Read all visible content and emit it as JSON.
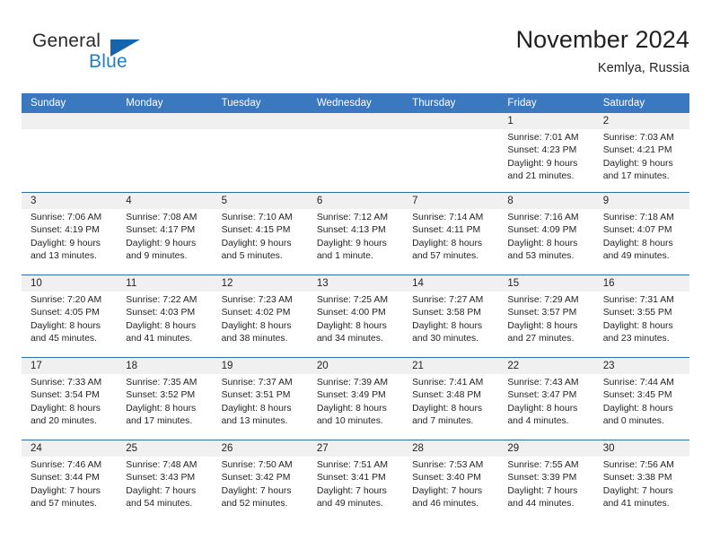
{
  "brand": {
    "name_part1": "General",
    "name_part2": "Blue",
    "triangle_color": "#1664ad",
    "blue_color": "#1f7fc6"
  },
  "header": {
    "title": "November 2024",
    "subtitle": "Kemlya, Russia"
  },
  "theme": {
    "header_row_bg": "#3b78bf",
    "day_number_bg": "#f0f0f0",
    "row_divider": "#2e6ba8",
    "text": "#231f20"
  },
  "weekdays": [
    "Sunday",
    "Monday",
    "Tuesday",
    "Wednesday",
    "Thursday",
    "Friday",
    "Saturday"
  ],
  "weeks": [
    [
      {
        "date": "",
        "sunrise": "",
        "sunset": "",
        "daylight_line1": "",
        "daylight_line2": ""
      },
      {
        "date": "",
        "sunrise": "",
        "sunset": "",
        "daylight_line1": "",
        "daylight_line2": ""
      },
      {
        "date": "",
        "sunrise": "",
        "sunset": "",
        "daylight_line1": "",
        "daylight_line2": ""
      },
      {
        "date": "",
        "sunrise": "",
        "sunset": "",
        "daylight_line1": "",
        "daylight_line2": ""
      },
      {
        "date": "",
        "sunrise": "",
        "sunset": "",
        "daylight_line1": "",
        "daylight_line2": ""
      },
      {
        "date": "1",
        "sunrise": "Sunrise: 7:01 AM",
        "sunset": "Sunset: 4:23 PM",
        "daylight_line1": "Daylight: 9 hours",
        "daylight_line2": "and 21 minutes."
      },
      {
        "date": "2",
        "sunrise": "Sunrise: 7:03 AM",
        "sunset": "Sunset: 4:21 PM",
        "daylight_line1": "Daylight: 9 hours",
        "daylight_line2": "and 17 minutes."
      }
    ],
    [
      {
        "date": "3",
        "sunrise": "Sunrise: 7:06 AM",
        "sunset": "Sunset: 4:19 PM",
        "daylight_line1": "Daylight: 9 hours",
        "daylight_line2": "and 13 minutes."
      },
      {
        "date": "4",
        "sunrise": "Sunrise: 7:08 AM",
        "sunset": "Sunset: 4:17 PM",
        "daylight_line1": "Daylight: 9 hours",
        "daylight_line2": "and 9 minutes."
      },
      {
        "date": "5",
        "sunrise": "Sunrise: 7:10 AM",
        "sunset": "Sunset: 4:15 PM",
        "daylight_line1": "Daylight: 9 hours",
        "daylight_line2": "and 5 minutes."
      },
      {
        "date": "6",
        "sunrise": "Sunrise: 7:12 AM",
        "sunset": "Sunset: 4:13 PM",
        "daylight_line1": "Daylight: 9 hours",
        "daylight_line2": "and 1 minute."
      },
      {
        "date": "7",
        "sunrise": "Sunrise: 7:14 AM",
        "sunset": "Sunset: 4:11 PM",
        "daylight_line1": "Daylight: 8 hours",
        "daylight_line2": "and 57 minutes."
      },
      {
        "date": "8",
        "sunrise": "Sunrise: 7:16 AM",
        "sunset": "Sunset: 4:09 PM",
        "daylight_line1": "Daylight: 8 hours",
        "daylight_line2": "and 53 minutes."
      },
      {
        "date": "9",
        "sunrise": "Sunrise: 7:18 AM",
        "sunset": "Sunset: 4:07 PM",
        "daylight_line1": "Daylight: 8 hours",
        "daylight_line2": "and 49 minutes."
      }
    ],
    [
      {
        "date": "10",
        "sunrise": "Sunrise: 7:20 AM",
        "sunset": "Sunset: 4:05 PM",
        "daylight_line1": "Daylight: 8 hours",
        "daylight_line2": "and 45 minutes."
      },
      {
        "date": "11",
        "sunrise": "Sunrise: 7:22 AM",
        "sunset": "Sunset: 4:03 PM",
        "daylight_line1": "Daylight: 8 hours",
        "daylight_line2": "and 41 minutes."
      },
      {
        "date": "12",
        "sunrise": "Sunrise: 7:23 AM",
        "sunset": "Sunset: 4:02 PM",
        "daylight_line1": "Daylight: 8 hours",
        "daylight_line2": "and 38 minutes."
      },
      {
        "date": "13",
        "sunrise": "Sunrise: 7:25 AM",
        "sunset": "Sunset: 4:00 PM",
        "daylight_line1": "Daylight: 8 hours",
        "daylight_line2": "and 34 minutes."
      },
      {
        "date": "14",
        "sunrise": "Sunrise: 7:27 AM",
        "sunset": "Sunset: 3:58 PM",
        "daylight_line1": "Daylight: 8 hours",
        "daylight_line2": "and 30 minutes."
      },
      {
        "date": "15",
        "sunrise": "Sunrise: 7:29 AM",
        "sunset": "Sunset: 3:57 PM",
        "daylight_line1": "Daylight: 8 hours",
        "daylight_line2": "and 27 minutes."
      },
      {
        "date": "16",
        "sunrise": "Sunrise: 7:31 AM",
        "sunset": "Sunset: 3:55 PM",
        "daylight_line1": "Daylight: 8 hours",
        "daylight_line2": "and 23 minutes."
      }
    ],
    [
      {
        "date": "17",
        "sunrise": "Sunrise: 7:33 AM",
        "sunset": "Sunset: 3:54 PM",
        "daylight_line1": "Daylight: 8 hours",
        "daylight_line2": "and 20 minutes."
      },
      {
        "date": "18",
        "sunrise": "Sunrise: 7:35 AM",
        "sunset": "Sunset: 3:52 PM",
        "daylight_line1": "Daylight: 8 hours",
        "daylight_line2": "and 17 minutes."
      },
      {
        "date": "19",
        "sunrise": "Sunrise: 7:37 AM",
        "sunset": "Sunset: 3:51 PM",
        "daylight_line1": "Daylight: 8 hours",
        "daylight_line2": "and 13 minutes."
      },
      {
        "date": "20",
        "sunrise": "Sunrise: 7:39 AM",
        "sunset": "Sunset: 3:49 PM",
        "daylight_line1": "Daylight: 8 hours",
        "daylight_line2": "and 10 minutes."
      },
      {
        "date": "21",
        "sunrise": "Sunrise: 7:41 AM",
        "sunset": "Sunset: 3:48 PM",
        "daylight_line1": "Daylight: 8 hours",
        "daylight_line2": "and 7 minutes."
      },
      {
        "date": "22",
        "sunrise": "Sunrise: 7:43 AM",
        "sunset": "Sunset: 3:47 PM",
        "daylight_line1": "Daylight: 8 hours",
        "daylight_line2": "and 4 minutes."
      },
      {
        "date": "23",
        "sunrise": "Sunrise: 7:44 AM",
        "sunset": "Sunset: 3:45 PM",
        "daylight_line1": "Daylight: 8 hours",
        "daylight_line2": "and 0 minutes."
      }
    ],
    [
      {
        "date": "24",
        "sunrise": "Sunrise: 7:46 AM",
        "sunset": "Sunset: 3:44 PM",
        "daylight_line1": "Daylight: 7 hours",
        "daylight_line2": "and 57 minutes."
      },
      {
        "date": "25",
        "sunrise": "Sunrise: 7:48 AM",
        "sunset": "Sunset: 3:43 PM",
        "daylight_line1": "Daylight: 7 hours",
        "daylight_line2": "and 54 minutes."
      },
      {
        "date": "26",
        "sunrise": "Sunrise: 7:50 AM",
        "sunset": "Sunset: 3:42 PM",
        "daylight_line1": "Daylight: 7 hours",
        "daylight_line2": "and 52 minutes."
      },
      {
        "date": "27",
        "sunrise": "Sunrise: 7:51 AM",
        "sunset": "Sunset: 3:41 PM",
        "daylight_line1": "Daylight: 7 hours",
        "daylight_line2": "and 49 minutes."
      },
      {
        "date": "28",
        "sunrise": "Sunrise: 7:53 AM",
        "sunset": "Sunset: 3:40 PM",
        "daylight_line1": "Daylight: 7 hours",
        "daylight_line2": "and 46 minutes."
      },
      {
        "date": "29",
        "sunrise": "Sunrise: 7:55 AM",
        "sunset": "Sunset: 3:39 PM",
        "daylight_line1": "Daylight: 7 hours",
        "daylight_line2": "and 44 minutes."
      },
      {
        "date": "30",
        "sunrise": "Sunrise: 7:56 AM",
        "sunset": "Sunset: 3:38 PM",
        "daylight_line1": "Daylight: 7 hours",
        "daylight_line2": "and 41 minutes."
      }
    ]
  ]
}
